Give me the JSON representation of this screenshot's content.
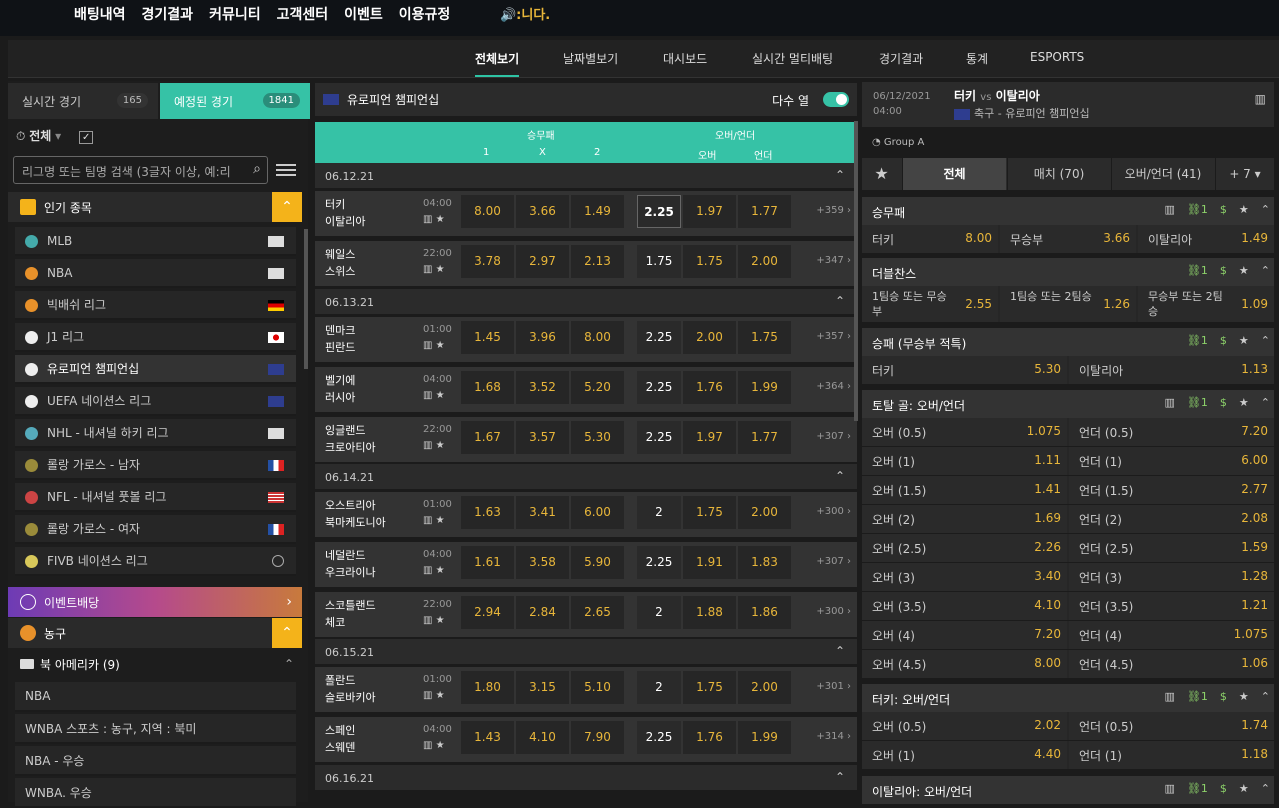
{
  "top_nav": [
    "배팅내역",
    "경기결과",
    "커뮤니티",
    "고객센터",
    "이벤트",
    "이용규정"
  ],
  "marquee": "🔊:니다.",
  "sub_nav": [
    "전체보기",
    "날짜별보기",
    "대시보드",
    "실시간 멀티배팅",
    "경기결과",
    "통계",
    "ESPORTS"
  ],
  "left": {
    "live_tab": "실시간 경기",
    "live_count": "165",
    "sched_tab": "예정된 경기",
    "sched_count": "1841",
    "filter": "전체",
    "search_placeholder": "리그명 또는 팀명 검색 (3글자 이상, 예:리",
    "popular": "인기 종목",
    "sports": [
      "MLB",
      "NBA",
      "빅배쉬 리그",
      "J1 리그",
      "유로피언 챔피언십",
      "UEFA 네이션스 리그",
      "NHL - 내셔널 하키 리그",
      "롤랑 가로스 - 남자",
      "NFL - 내셔널 풋볼 리그",
      "롤랑 가로스 - 여자",
      "FIVB 네이션스 리그"
    ],
    "event": "이벤트배당",
    "basketball": "농구",
    "na": "북 아메리카 (9)",
    "leagues": [
      "NBA",
      "WNBA 스포츠 : 농구, 지역 : 북미",
      "NBA - 우승",
      "WNBA. 우승"
    ]
  },
  "center": {
    "league": "유로피언 챔피언십",
    "multi_col": "다수 열",
    "hdr": {
      "g1": "승무패",
      "g2": "오버/언더",
      "c1": "1",
      "cx": "X",
      "c2": "2",
      "over": "오버",
      "under": "언더"
    },
    "dates": [
      "06.12.21",
      "06.13.21",
      "06.14.21",
      "06.15.21",
      "06.16.21"
    ],
    "games": [
      {
        "t1": "터키",
        "t2": "이탈리아",
        "time": "04:00",
        "o": [
          "8.00",
          "3.66",
          "1.49"
        ],
        "hc": "2.25",
        "ou": [
          "1.97",
          "1.77"
        ],
        "more": "+359"
      },
      {
        "t1": "웨일스",
        "t2": "스위스",
        "time": "22:00",
        "o": [
          "3.78",
          "2.97",
          "2.13"
        ],
        "hc": "1.75",
        "ou": [
          "1.75",
          "2.00"
        ],
        "more": "+347"
      },
      {
        "t1": "덴마크",
        "t2": "핀란드",
        "time": "01:00",
        "o": [
          "1.45",
          "3.96",
          "8.00"
        ],
        "hc": "2.25",
        "ou": [
          "2.00",
          "1.75"
        ],
        "more": "+357"
      },
      {
        "t1": "벨기에",
        "t2": "러시아",
        "time": "04:00",
        "o": [
          "1.68",
          "3.52",
          "5.20"
        ],
        "hc": "2.25",
        "ou": [
          "1.76",
          "1.99"
        ],
        "more": "+364"
      },
      {
        "t1": "잉글랜드",
        "t2": "크로아티아",
        "time": "22:00",
        "o": [
          "1.67",
          "3.57",
          "5.30"
        ],
        "hc": "2.25",
        "ou": [
          "1.97",
          "1.77"
        ],
        "more": "+307"
      },
      {
        "t1": "오스트리아",
        "t2": "북마케도니아",
        "time": "01:00",
        "o": [
          "1.63",
          "3.41",
          "6.00"
        ],
        "hc": "2",
        "ou": [
          "1.75",
          "2.00"
        ],
        "more": "+300"
      },
      {
        "t1": "네덜란드",
        "t2": "우크라이나",
        "time": "04:00",
        "o": [
          "1.61",
          "3.58",
          "5.90"
        ],
        "hc": "2.25",
        "ou": [
          "1.91",
          "1.83"
        ],
        "more": "+307"
      },
      {
        "t1": "스코틀랜드",
        "t2": "체코",
        "time": "22:00",
        "o": [
          "2.94",
          "2.84",
          "2.65"
        ],
        "hc": "2",
        "ou": [
          "1.88",
          "1.86"
        ],
        "more": "+300"
      },
      {
        "t1": "폴란드",
        "t2": "슬로바키아",
        "time": "01:00",
        "o": [
          "1.80",
          "3.15",
          "5.10"
        ],
        "hc": "2",
        "ou": [
          "1.75",
          "2.00"
        ],
        "more": "+301"
      },
      {
        "t1": "스페인",
        "t2": "스웨덴",
        "time": "04:00",
        "o": [
          "1.43",
          "4.10",
          "7.90"
        ],
        "hc": "2.25",
        "ou": [
          "1.76",
          "1.99"
        ],
        "more": "+314"
      }
    ]
  },
  "right": {
    "date": "06/12/2021",
    "time": "04:00",
    "match_a": "터키",
    "vs": "vs",
    "match_b": "이탈리아",
    "league": "축구 - 유로피언 챔피언십",
    "group": "Group A",
    "tabs": [
      "전체",
      "매치 (70)",
      "오버/언더 (41)",
      "+ 7"
    ],
    "m1": {
      "title": "승무패",
      "link": "1",
      "cells": [
        [
          "터키",
          "8.00"
        ],
        [
          "무승부",
          "3.66"
        ],
        [
          "이탈리아",
          "1.49"
        ]
      ]
    },
    "m2": {
      "title": "더블찬스",
      "link": "1",
      "cells": [
        [
          "1팀승 또는 무승부",
          "2.55"
        ],
        [
          "1팀승 또는 2팀승",
          "1.26"
        ],
        [
          "무승부 또는 2팀승",
          "1.09"
        ]
      ]
    },
    "m3": {
      "title": "승패 (무승부 적특)",
      "link": "1",
      "cells": [
        [
          "터키",
          "5.30"
        ],
        [
          "이탈리아",
          "1.13"
        ]
      ]
    },
    "m4": {
      "title": "토탈 골: 오버/언더",
      "link": "1",
      "rows": [
        [
          "오버 (0.5)",
          "1.075",
          "언더 (0.5)",
          "7.20"
        ],
        [
          "오버 (1)",
          "1.11",
          "언더 (1)",
          "6.00"
        ],
        [
          "오버 (1.5)",
          "1.41",
          "언더 (1.5)",
          "2.77"
        ],
        [
          "오버 (2)",
          "1.69",
          "언더 (2)",
          "2.08"
        ],
        [
          "오버 (2.5)",
          "2.26",
          "언더 (2.5)",
          "1.59"
        ],
        [
          "오버 (3)",
          "3.40",
          "언더 (3)",
          "1.28"
        ],
        [
          "오버 (3.5)",
          "4.10",
          "언더 (3.5)",
          "1.21"
        ],
        [
          "오버 (4)",
          "7.20",
          "언더 (4)",
          "1.075"
        ],
        [
          "오버 (4.5)",
          "8.00",
          "언더 (4.5)",
          "1.06"
        ]
      ]
    },
    "m5": {
      "title": "터키: 오버/언더",
      "link": "1",
      "rows": [
        [
          "오버 (0.5)",
          "2.02",
          "언더 (0.5)",
          "1.74"
        ],
        [
          "오버 (1)",
          "4.40",
          "언더 (1)",
          "1.18"
        ]
      ]
    },
    "m6": {
      "title": "이탈리아: 오버/언더",
      "link": "1"
    }
  }
}
